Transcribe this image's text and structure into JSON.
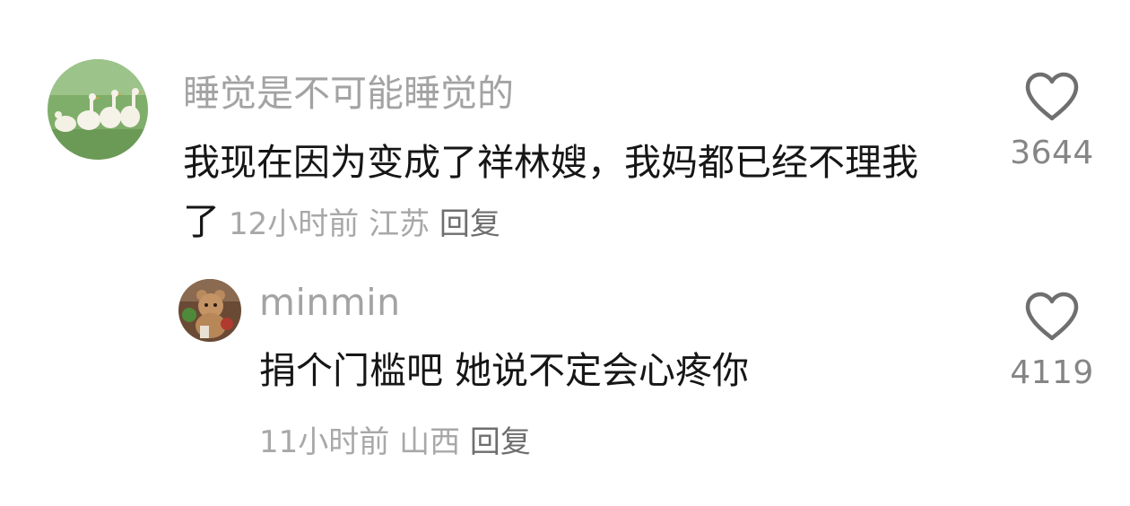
{
  "comments": [
    {
      "username": "睡觉是不可能睡觉的",
      "text": "我现在因为变成了祥林嫂，我妈都已经不理我了",
      "time": "12小时前",
      "location": "江苏",
      "reply_label": "回复",
      "likes": "3644",
      "avatar": "avatar-geese-icon",
      "like_icon": "heart-icon"
    },
    {
      "username": "minmin",
      "text": "捐个门槛吧 她说不定会心疼你",
      "time": "11小时前",
      "location": "山西",
      "reply_label": "回复",
      "likes": "4119",
      "avatar": "avatar-teddy-bear-icon",
      "like_icon": "heart-icon"
    }
  ],
  "colors": {
    "username": "#a3a3a3",
    "text": "#161616",
    "meta": "#a8a8a8",
    "reply": "#6e6e6e",
    "like_count": "#858585"
  }
}
